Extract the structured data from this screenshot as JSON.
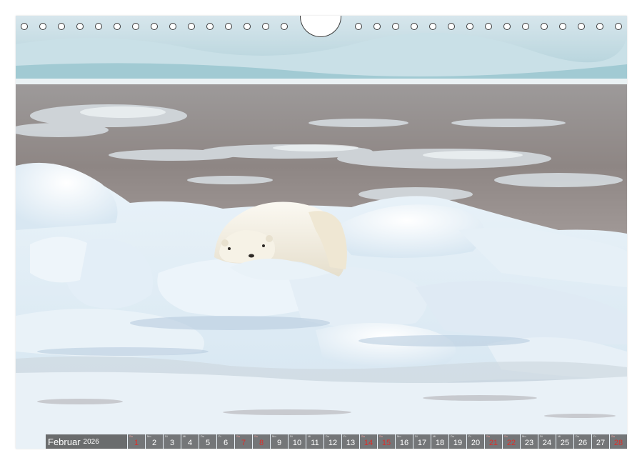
{
  "calendar": {
    "month": "Februar",
    "year": "2026",
    "days": [
      {
        "wd": "So",
        "num": "1",
        "red": true
      },
      {
        "wd": "Mo",
        "num": "2",
        "red": false
      },
      {
        "wd": "Di",
        "num": "3",
        "red": false
      },
      {
        "wd": "Mi",
        "num": "4",
        "red": false
      },
      {
        "wd": "Do",
        "num": "5",
        "red": false
      },
      {
        "wd": "Fr",
        "num": "6",
        "red": false
      },
      {
        "wd": "Sa",
        "num": "7",
        "red": true
      },
      {
        "wd": "So",
        "num": "8",
        "red": true
      },
      {
        "wd": "Mo",
        "num": "9",
        "red": false
      },
      {
        "wd": "Di",
        "num": "10",
        "red": false
      },
      {
        "wd": "Mi",
        "num": "11",
        "red": false
      },
      {
        "wd": "Do",
        "num": "12",
        "red": false
      },
      {
        "wd": "Fr",
        "num": "13",
        "red": false
      },
      {
        "wd": "Sa",
        "num": "14",
        "red": true
      },
      {
        "wd": "So",
        "num": "15",
        "red": true
      },
      {
        "wd": "Mo",
        "num": "16",
        "red": false
      },
      {
        "wd": "Di",
        "num": "17",
        "red": false
      },
      {
        "wd": "Mi",
        "num": "18",
        "red": false
      },
      {
        "wd": "Do",
        "num": "19",
        "red": false
      },
      {
        "wd": "Fr",
        "num": "20",
        "red": false
      },
      {
        "wd": "Sa",
        "num": "21",
        "red": true
      },
      {
        "wd": "So",
        "num": "22",
        "red": true
      },
      {
        "wd": "Mo",
        "num": "23",
        "red": false
      },
      {
        "wd": "Di",
        "num": "24",
        "red": false
      },
      {
        "wd": "Mi",
        "num": "25",
        "red": false
      },
      {
        "wd": "Do",
        "num": "26",
        "red": false
      },
      {
        "wd": "Fr",
        "num": "27",
        "red": false
      },
      {
        "wd": "Sa",
        "num": "28",
        "red": true
      }
    ]
  },
  "colors": {
    "holiday": "#d9302b",
    "bar": "#464646"
  }
}
